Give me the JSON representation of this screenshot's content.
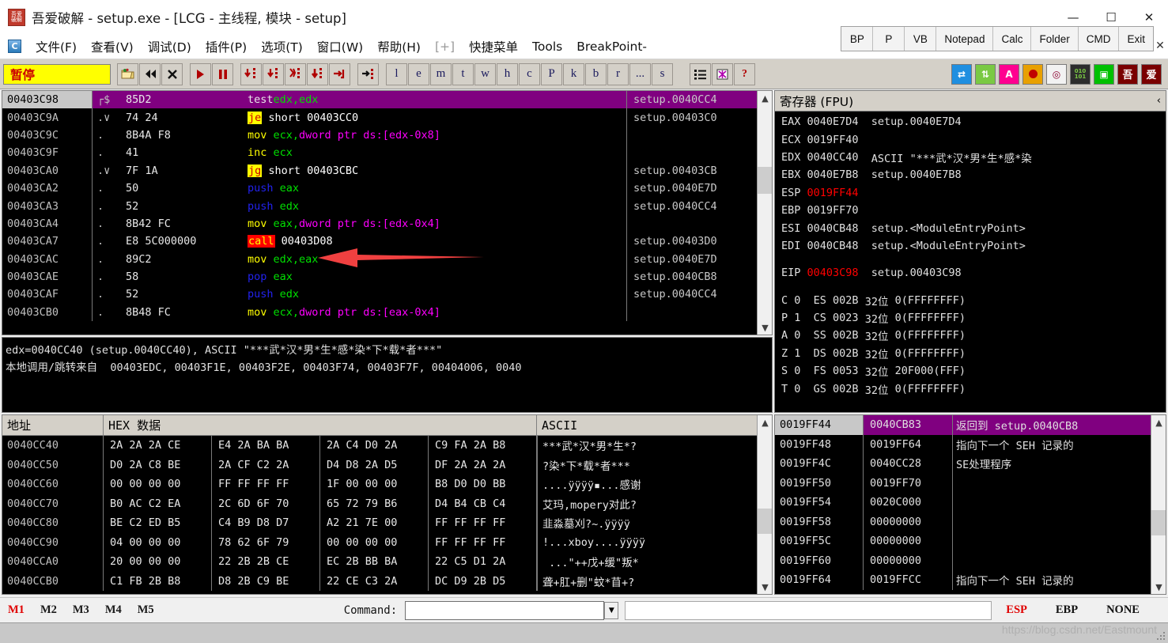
{
  "window": {
    "title": "吾爱破解 - setup.exe - [LCG -  主线程, 模块 - setup]",
    "icon": "wuaipojie-icon",
    "minimize": "—",
    "maximize": "☐",
    "close": "✕"
  },
  "menu": {
    "app_icon_label": "C",
    "items": [
      {
        "label": "文件(F)",
        "dim": false
      },
      {
        "label": "查看(V)",
        "dim": false
      },
      {
        "label": "调试(D)",
        "dim": false
      },
      {
        "label": "插件(P)",
        "dim": false
      },
      {
        "label": "选项(T)",
        "dim": false
      },
      {
        "label": "窗口(W)",
        "dim": false
      },
      {
        "label": "帮助(H)",
        "dim": false
      },
      {
        "label": "[+]",
        "dim": true
      },
      {
        "label": "快捷菜单",
        "dim": false
      },
      {
        "label": "Tools",
        "dim": false
      },
      {
        "label": "BreakPoint-",
        "dim": false
      }
    ],
    "close_x": "✕"
  },
  "quickbar": {
    "buttons": [
      "BP",
      "P",
      "VB",
      "Notepad",
      "Calc",
      "Folder",
      "CMD",
      "Exit"
    ]
  },
  "toolbar": {
    "status": "暂停",
    "nav_buttons": [
      {
        "name": "open-file-icon",
        "glyph": "📂"
      },
      {
        "name": "restart-icon",
        "glyph": "◀◀"
      },
      {
        "name": "close-program-icon",
        "glyph": "✕"
      }
    ],
    "run_buttons": [
      {
        "name": "run-icon",
        "glyph": "▶"
      },
      {
        "name": "pause-icon",
        "glyph": "❚❚"
      }
    ],
    "step_buttons": [
      {
        "name": "step-into-icon",
        "glyph": "↳"
      },
      {
        "name": "step-over-icon",
        "glyph": "↓"
      },
      {
        "name": "trace-into-icon",
        "glyph": "⇉"
      },
      {
        "name": "trace-over-icon",
        "glyph": "⇊"
      },
      {
        "name": "execute-till-return-icon",
        "glyph": "→|"
      }
    ],
    "run-to-cursor": {
      "name": "run-to-cursor-icon",
      "glyph": "→⋮"
    },
    "letters": [
      "l",
      "e",
      "m",
      "t",
      "w",
      "h",
      "c",
      "P",
      "k",
      "b",
      "r",
      "...",
      "s"
    ],
    "extra": [
      {
        "name": "options-list-icon",
        "glyph": "≔"
      },
      {
        "name": "patches-icon",
        "glyph": "▩"
      },
      {
        "name": "help-icon",
        "glyph": "?"
      }
    ],
    "plugins": [
      {
        "name": "swap-plugin-icon",
        "glyph": "⇄",
        "color": "#00a0ff"
      },
      {
        "name": "updown-plugin-icon",
        "glyph": "↑↓",
        "color": "#7ac943"
      },
      {
        "name": "ascii-plugin-icon",
        "glyph": "A",
        "color": "#ff0090"
      },
      {
        "name": "breakpoint-plugin-icon",
        "glyph": "●",
        "color": "#e8a000"
      },
      {
        "name": "target-plugin-icon",
        "glyph": "◎",
        "color": "#8b0030"
      },
      {
        "name": "binary-plugin-icon",
        "glyph": "010",
        "color": "#2d2d2d"
      },
      {
        "name": "window-plugin-icon",
        "glyph": "▣",
        "color": "#00c000"
      },
      {
        "name": "wu-plugin-icon",
        "glyph": "吾",
        "color": "#7a0000"
      },
      {
        "name": "ai-plugin-icon",
        "glyph": "爱",
        "color": "#7a0000"
      }
    ]
  },
  "disassembly": {
    "rows": [
      {
        "addr": "00403C98",
        "mark": "┌$",
        "hex": "85D2",
        "mnemonic": "test",
        "mn_class": "mn",
        "operands": [
          {
            "t": "edx,edx",
            "c": "op-reg"
          }
        ],
        "comment": "setup.0040CC4",
        "selected": true
      },
      {
        "addr": "00403C9A",
        "mark": ".∨",
        "hex": "74 24",
        "mnemonic": "je",
        "mn_class": "mn-jmp-hl",
        "operands": [
          {
            "t": " short 00403CC0",
            "c": "op-num"
          }
        ],
        "comment": "setup.00403C0",
        "selected": false
      },
      {
        "addr": "00403C9C",
        "mark": ".",
        "hex": "8B4A F8",
        "mnemonic": "mov",
        "mn_class": "mn-mov",
        "operands": [
          {
            "t": " ecx,",
            "c": "op-reg"
          },
          {
            "t": "dword ptr ds:[edx-0x8]",
            "c": "op-mem"
          }
        ],
        "comment": "",
        "selected": false
      },
      {
        "addr": "00403C9F",
        "mark": ".",
        "hex": "41",
        "mnemonic": "inc",
        "mn_class": "mn-mov",
        "operands": [
          {
            "t": " ecx",
            "c": "op-reg"
          }
        ],
        "comment": "",
        "selected": false
      },
      {
        "addr": "00403CA0",
        "mark": ".∨",
        "hex": "7F 1A",
        "mnemonic": "jg",
        "mn_class": "mn-jmp-hl",
        "operands": [
          {
            "t": " short 00403CBC",
            "c": "op-num"
          }
        ],
        "comment": "setup.00403CB",
        "selected": false
      },
      {
        "addr": "00403CA2",
        "mark": ".",
        "hex": "50",
        "mnemonic": "push",
        "mn_class": "mn-push",
        "operands": [
          {
            "t": " eax",
            "c": "op-reg"
          }
        ],
        "comment": "setup.0040E7D",
        "selected": false
      },
      {
        "addr": "00403CA3",
        "mark": ".",
        "hex": "52",
        "mnemonic": "push",
        "mn_class": "mn-push",
        "operands": [
          {
            "t": " edx",
            "c": "op-reg"
          }
        ],
        "comment": "setup.0040CC4",
        "selected": false
      },
      {
        "addr": "00403CA4",
        "mark": ".",
        "hex": "8B42 FC",
        "mnemonic": "mov",
        "mn_class": "mn-mov",
        "operands": [
          {
            "t": " eax,",
            "c": "op-reg"
          },
          {
            "t": "dword ptr ds:[edx-0x4]",
            "c": "op-mem"
          }
        ],
        "comment": "",
        "selected": false
      },
      {
        "addr": "00403CA7",
        "mark": ".",
        "hex": "E8 5C000000",
        "mnemonic": "call",
        "mn_class": "mn-call-hl",
        "operands": [
          {
            "t": " 00403D08",
            "c": "op-num"
          }
        ],
        "comment": "setup.00403D0",
        "selected": false
      },
      {
        "addr": "00403CAC",
        "mark": ".",
        "hex": "89C2",
        "mnemonic": "mov",
        "mn_class": "mn-mov",
        "operands": [
          {
            "t": " edx,eax",
            "c": "op-reg"
          }
        ],
        "comment": "setup.0040E7D",
        "selected": false
      },
      {
        "addr": "00403CAE",
        "mark": ".",
        "hex": "58",
        "mnemonic": "pop",
        "mn_class": "mn-push",
        "operands": [
          {
            "t": " eax",
            "c": "op-reg"
          }
        ],
        "comment": "setup.0040CB8",
        "selected": false
      },
      {
        "addr": "00403CAF",
        "mark": ".",
        "hex": "52",
        "mnemonic": "push",
        "mn_class": "mn-push",
        "operands": [
          {
            "t": " edx",
            "c": "op-reg"
          }
        ],
        "comment": "setup.0040CC4",
        "selected": false
      },
      {
        "addr": "00403CB0",
        "mark": ".",
        "hex": "8B48 FC",
        "mnemonic": "mov",
        "mn_class": "mn-mov",
        "operands": [
          {
            "t": " ecx,",
            "c": "op-reg"
          },
          {
            "t": "dword ptr ds:[eax-0x4]",
            "c": "op-mem"
          }
        ],
        "comment": "",
        "selected": false
      }
    ],
    "annotation_arrow": "red-left-arrow pointing at call 00403D08"
  },
  "info_pane": {
    "line1": "edx=0040CC40 (setup.0040CC40), ASCII \"***武*汉*男*生*感*染*下*载*者***\"",
    "line2": "本地调用/跳转来自  00403EDC, 00403F1E, 00403F2E, 00403F74, 00403F7F, 00404006, 0040"
  },
  "registers": {
    "title": "寄存器 (FPU)",
    "collapse": "‹",
    "gp": [
      {
        "name": "EAX",
        "value": "0040E7D4",
        "red": false,
        "comment": "setup.0040E7D4"
      },
      {
        "name": "ECX",
        "value": "0019FF40",
        "red": false,
        "comment": ""
      },
      {
        "name": "EDX",
        "value": "0040CC40",
        "red": false,
        "comment": "ASCII \"***武*汉*男*生*感*染"
      },
      {
        "name": "EBX",
        "value": "0040E7B8",
        "red": false,
        "comment": "setup.0040E7B8"
      },
      {
        "name": "ESP",
        "value": "0019FF44",
        "red": true,
        "comment": ""
      },
      {
        "name": "EBP",
        "value": "0019FF70",
        "red": false,
        "comment": ""
      },
      {
        "name": "ESI",
        "value": "0040CB48",
        "red": false,
        "comment": "setup.<ModuleEntryPoint>"
      },
      {
        "name": "EDI",
        "value": "0040CB48",
        "red": false,
        "comment": "setup.<ModuleEntryPoint>"
      }
    ],
    "eip": {
      "name": "EIP",
      "value": "00403C98",
      "red": true,
      "comment": "setup.00403C98"
    },
    "flags": [
      {
        "flag": "C",
        "fval": "0",
        "seg": "ES",
        "sval": "002B",
        "bits": "32位",
        "range": "0(FFFFFFFF)"
      },
      {
        "flag": "P",
        "fval": "1",
        "seg": "CS",
        "sval": "0023",
        "bits": "32位",
        "range": "0(FFFFFFFF)"
      },
      {
        "flag": "A",
        "fval": "0",
        "seg": "SS",
        "sval": "002B",
        "bits": "32位",
        "range": "0(FFFFFFFF)"
      },
      {
        "flag": "Z",
        "fval": "1",
        "seg": "DS",
        "sval": "002B",
        "bits": "32位",
        "range": "0(FFFFFFFF)"
      },
      {
        "flag": "S",
        "fval": "0",
        "seg": "FS",
        "sval": "0053",
        "bits": "32位",
        "range": "20F000(FFF)"
      },
      {
        "flag": "T",
        "fval": "0",
        "seg": "GS",
        "sval": "002B",
        "bits": "32位",
        "range": "0(FFFFFFFF)"
      }
    ]
  },
  "dump": {
    "headers": {
      "address": "地址",
      "hex": "HEX 数据",
      "ascii": "ASCII"
    },
    "rows": [
      {
        "addr": "0040CC40",
        "g1": "2A 2A 2A CE",
        "g2": "E4 2A BA BA",
        "g3": "2A C4 D0 2A",
        "g4": "C9 FA 2A B8",
        "ascii": "***武*汉*男*生*?"
      },
      {
        "addr": "0040CC50",
        "g1": "D0 2A C8 BE",
        "g2": "2A CF C2 2A",
        "g3": "D4 D8 2A D5",
        "g4": "DF 2A 2A 2A",
        "ascii": "?染*下*载*者***"
      },
      {
        "addr": "0040CC60",
        "g1": "00 00 00 00",
        "g2": "FF FF FF FF",
        "g3": "1F 00 00 00",
        "g4": "B8 D0 D0 BB",
        "ascii": "....ÿÿÿÿ▪...感谢"
      },
      {
        "addr": "0040CC70",
        "g1": "B0 AC C2 EA",
        "g2": "2C 6D 6F 70",
        "g3": "65 72 79 B6",
        "g4": "D4 B4 CB C4",
        "ascii": "艾玛,mopery对此?"
      },
      {
        "addr": "0040CC80",
        "g1": "BE C2 ED B5",
        "g2": "C4 B9 D8 D7",
        "g3": "A2 21 7E 00",
        "g4": "FF FF FF FF",
        "ascii": "韭淼墓刈?~.ÿÿÿÿ"
      },
      {
        "addr": "0040CC90",
        "g1": "04 00 00 00",
        "g2": "78 62 6F 79",
        "g3": "00 00 00 00",
        "g4": "FF FF FF FF",
        "ascii": "!...xboy....ÿÿÿÿ"
      },
      {
        "addr": "0040CCA0",
        "g1": "20 00 00 00",
        "g2": "22 2B 2B CE",
        "g3": "EC 2B BB BA",
        "g4": "22 C5 D1 2A",
        "ascii": " ...\"++戊+缓\"叛*"
      },
      {
        "addr": "0040CCB0",
        "g1": "C1 FB 2B B8",
        "g2": "D8 2B C9 BE",
        "g3": "22 CE C3 2A",
        "g4": "DC D9 2B D5",
        "ascii": "聋+肛+删\"蚊*苜+?"
      }
    ]
  },
  "stack": {
    "rows": [
      {
        "addr": "0019FF44",
        "value": "0040CB83",
        "comment": "返回到 setup.0040CB8",
        "selected": true
      },
      {
        "addr": "0019FF48",
        "value": "0019FF64",
        "comment": "指向下一个 SEH 记录的",
        "selected": false
      },
      {
        "addr": "0019FF4C",
        "value": "0040CC28",
        "comment": "SE处理程序",
        "selected": false
      },
      {
        "addr": "0019FF50",
        "value": "0019FF70",
        "comment": "",
        "selected": false
      },
      {
        "addr": "0019FF54",
        "value": "0020C000",
        "comment": "",
        "selected": false
      },
      {
        "addr": "0019FF58",
        "value": "00000000",
        "comment": "",
        "selected": false
      },
      {
        "addr": "0019FF5C",
        "value": "00000000",
        "comment": "",
        "selected": false
      },
      {
        "addr": "0019FF60",
        "value": "00000000",
        "comment": "",
        "selected": false
      },
      {
        "addr": "0019FF64",
        "value": "0019FFCC",
        "comment": "指向下一个 SEH 记录的",
        "selected": false
      }
    ]
  },
  "bottom": {
    "memory_buttons": [
      {
        "label": "M1",
        "red": true
      },
      {
        "label": "M2",
        "red": false
      },
      {
        "label": "M3",
        "red": false
      },
      {
        "label": "M4",
        "red": false
      },
      {
        "label": "M5",
        "red": false
      }
    ],
    "command_label": "Command:",
    "command_value": "",
    "command_placeholder": "",
    "dropdown_icon": "▼",
    "register_flags": [
      {
        "label": "ESP",
        "red": true
      },
      {
        "label": "EBP",
        "red": false
      },
      {
        "label": "NONE",
        "red": false
      }
    ]
  },
  "watermark": "https://blog.csdn.net/Eastmount",
  "colors": {
    "selection_purple": "#800080",
    "highlight_yellow": "#ffff00",
    "call_red": "#ff0000",
    "register_red": "#ff0000",
    "toolbar_gray": "#d4d0c8",
    "panel_black": "#000000"
  }
}
